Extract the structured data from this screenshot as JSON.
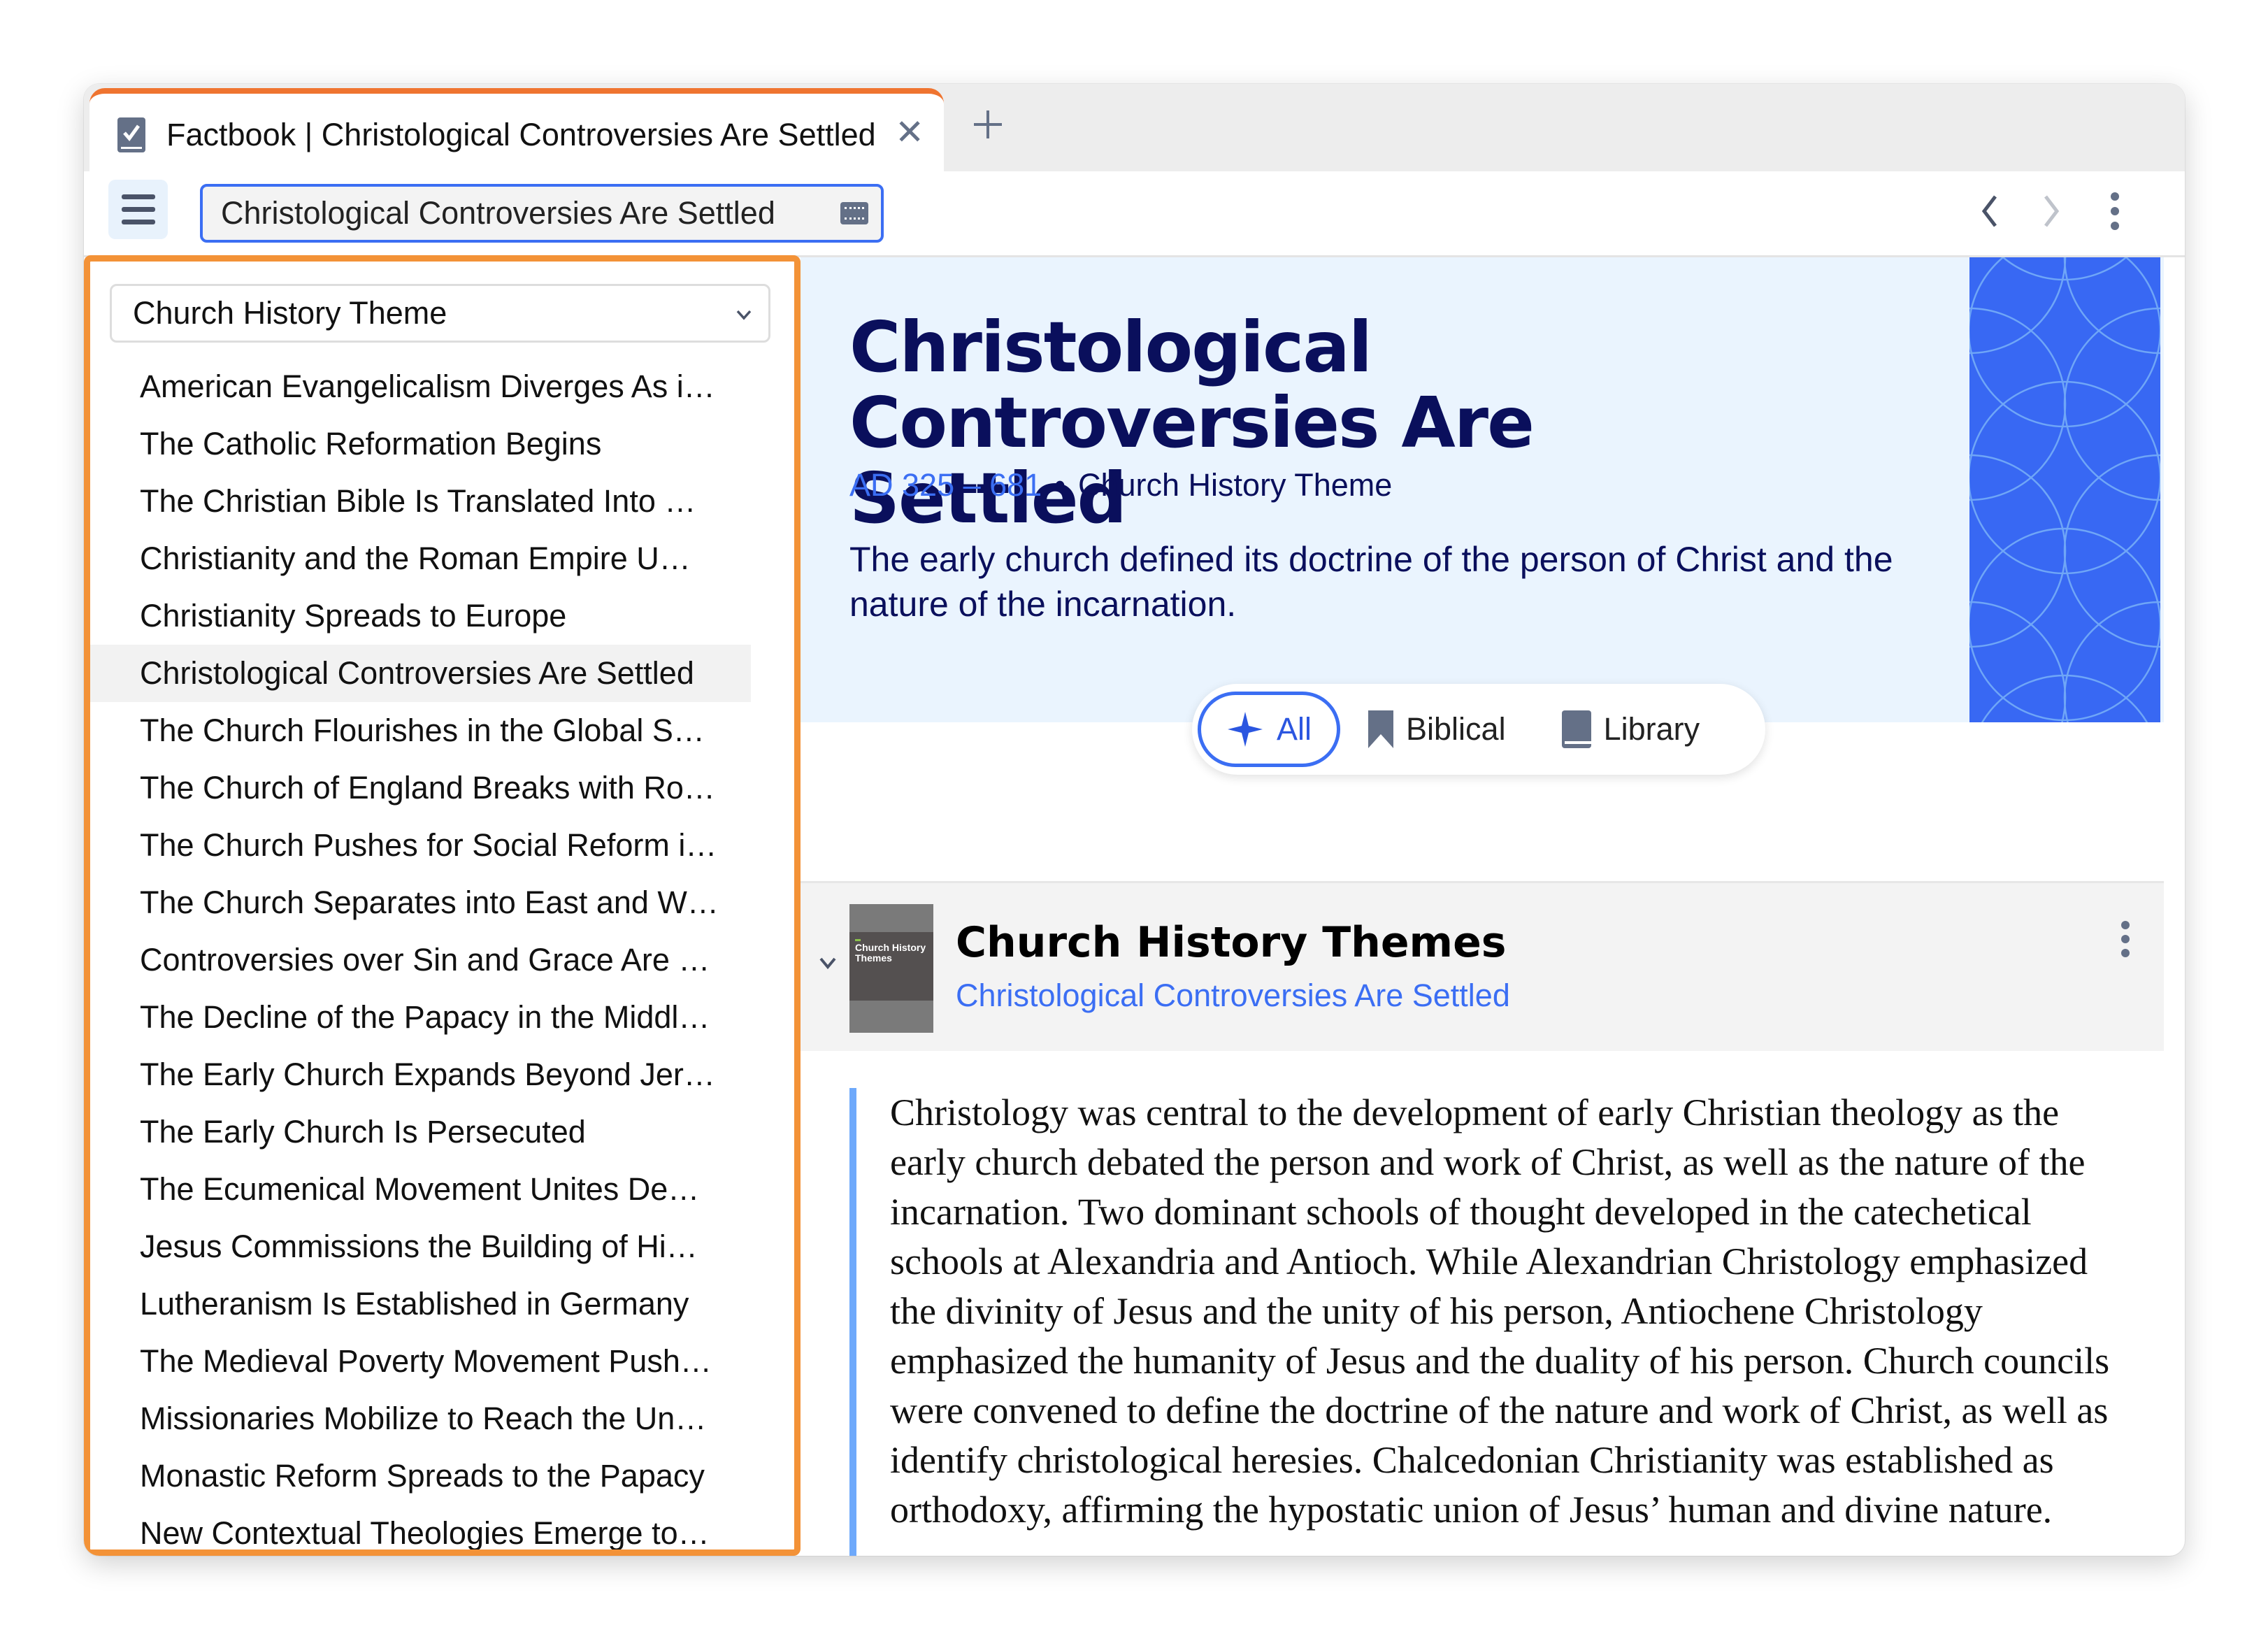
{
  "tab": {
    "icon": "factbook-check-icon",
    "title": "Factbook | Christological Controversies Are Settled",
    "close_icon": "close-icon",
    "new_tab_icon": "plus-icon"
  },
  "toolbar": {
    "menu_icon": "hamburger-menu-icon",
    "search_value": "Christological Controversies Are Settled",
    "keyboard_icon": "keyboard-icon",
    "back_icon": "chevron-left-icon",
    "forward_icon": "chevron-right-icon",
    "more_icon": "more-vertical-icon"
  },
  "sidebar": {
    "dropdown_selected": "Church History Theme",
    "items": [
      {
        "label": "American Evangelicalism Diverges As i…",
        "active": false
      },
      {
        "label": "The Catholic Reformation Begins",
        "active": false
      },
      {
        "label": "The Christian Bible Is Translated Into …",
        "active": false
      },
      {
        "label": "Christianity and the Roman Empire U…",
        "active": false
      },
      {
        "label": "Christianity Spreads to Europe",
        "active": false
      },
      {
        "label": "Christological Controversies Are Settled",
        "active": true
      },
      {
        "label": "The Church Flourishes in the Global S…",
        "active": false
      },
      {
        "label": "The Church of England Breaks with Ro…",
        "active": false
      },
      {
        "label": "The Church Pushes for Social Reform i…",
        "active": false
      },
      {
        "label": "The Church Separates into East and W…",
        "active": false
      },
      {
        "label": "Controversies over Sin and Grace Are …",
        "active": false
      },
      {
        "label": "The Decline of the Papacy in the Middl…",
        "active": false
      },
      {
        "label": "The Early Church Expands Beyond Jer…",
        "active": false
      },
      {
        "label": "The Early Church Is Persecuted",
        "active": false
      },
      {
        "label": "The Ecumenical Movement Unites De…",
        "active": false
      },
      {
        "label": "Jesus Commissions the Building of Hi…",
        "active": false
      },
      {
        "label": "Lutheranism Is Established in Germany",
        "active": false
      },
      {
        "label": "The Medieval Poverty Movement Push…",
        "active": false
      },
      {
        "label": "Missionaries Mobilize to Reach the Un…",
        "active": false
      },
      {
        "label": "Monastic Reform Spreads to the Papacy",
        "active": false
      },
      {
        "label": "New Contextual Theologies Emerge to…",
        "active": false
      }
    ]
  },
  "hero": {
    "title": "Christological Controversies Are Settled",
    "date_range": "AD 325 – 681",
    "separator": "•",
    "category": "Church History Theme",
    "description": "The early church defined its doctrine of the person of Christ and the nature of the incarnation."
  },
  "filters": [
    {
      "label": "All",
      "icon": "sparkle-icon",
      "active": true
    },
    {
      "label": "Biblical",
      "icon": "bookmark-icon",
      "active": false
    },
    {
      "label": "Library",
      "icon": "book-icon",
      "active": false
    }
  ],
  "resource": {
    "cover_text": "Church History Themes",
    "title": "Church History Themes",
    "subtitle": "Christological Controversies Are Settled"
  },
  "article": {
    "text": "Christology was central to the development of early Christian theology as the early church debated the person and work of Christ, as well as the nature of the incarnation. Two dominant schools of thought developed in the catechetical schools at Alexandria and Antioch. While Alexandrian Christology emphasized the divinity of Jesus and the unity of his person, Antiochene Christology emphasized the humanity of Jesus and the duality of his person. Church councils were convened to define the doctrine of the nature and work of Christ, as well as identify christological heresies. Chalcedonian Christianity was established as orthodoxy, affirming the hypostatic union of Jesus’ human and divine nature."
  },
  "colors": {
    "accent_orange": "#f39237",
    "tab_orange": "#ef7430",
    "accent_blue": "#3b6ef3",
    "hero_bg": "#eaf4fe",
    "title_navy": "#0a0f5c",
    "pattern_blue": "#3868f3"
  }
}
